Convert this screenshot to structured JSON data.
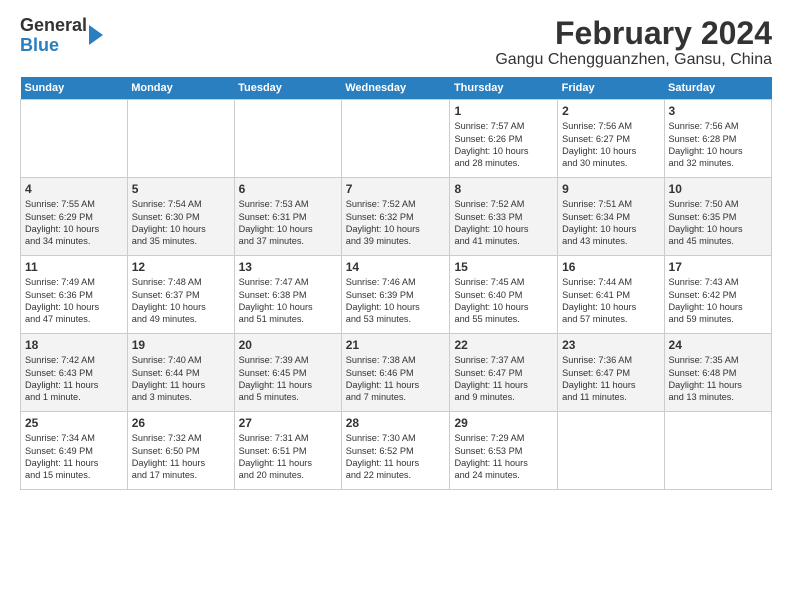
{
  "header": {
    "logo_line1": "General",
    "logo_line2": "Blue",
    "title": "February 2024",
    "subtitle": "Gangu Chengguanzhen, Gansu, China"
  },
  "weekdays": [
    "Sunday",
    "Monday",
    "Tuesday",
    "Wednesday",
    "Thursday",
    "Friday",
    "Saturday"
  ],
  "weeks": [
    [
      {
        "day": "",
        "info": ""
      },
      {
        "day": "",
        "info": ""
      },
      {
        "day": "",
        "info": ""
      },
      {
        "day": "",
        "info": ""
      },
      {
        "day": "1",
        "info": "Sunrise: 7:57 AM\nSunset: 6:26 PM\nDaylight: 10 hours\nand 28 minutes."
      },
      {
        "day": "2",
        "info": "Sunrise: 7:56 AM\nSunset: 6:27 PM\nDaylight: 10 hours\nand 30 minutes."
      },
      {
        "day": "3",
        "info": "Sunrise: 7:56 AM\nSunset: 6:28 PM\nDaylight: 10 hours\nand 32 minutes."
      }
    ],
    [
      {
        "day": "4",
        "info": "Sunrise: 7:55 AM\nSunset: 6:29 PM\nDaylight: 10 hours\nand 34 minutes."
      },
      {
        "day": "5",
        "info": "Sunrise: 7:54 AM\nSunset: 6:30 PM\nDaylight: 10 hours\nand 35 minutes."
      },
      {
        "day": "6",
        "info": "Sunrise: 7:53 AM\nSunset: 6:31 PM\nDaylight: 10 hours\nand 37 minutes."
      },
      {
        "day": "7",
        "info": "Sunrise: 7:52 AM\nSunset: 6:32 PM\nDaylight: 10 hours\nand 39 minutes."
      },
      {
        "day": "8",
        "info": "Sunrise: 7:52 AM\nSunset: 6:33 PM\nDaylight: 10 hours\nand 41 minutes."
      },
      {
        "day": "9",
        "info": "Sunrise: 7:51 AM\nSunset: 6:34 PM\nDaylight: 10 hours\nand 43 minutes."
      },
      {
        "day": "10",
        "info": "Sunrise: 7:50 AM\nSunset: 6:35 PM\nDaylight: 10 hours\nand 45 minutes."
      }
    ],
    [
      {
        "day": "11",
        "info": "Sunrise: 7:49 AM\nSunset: 6:36 PM\nDaylight: 10 hours\nand 47 minutes."
      },
      {
        "day": "12",
        "info": "Sunrise: 7:48 AM\nSunset: 6:37 PM\nDaylight: 10 hours\nand 49 minutes."
      },
      {
        "day": "13",
        "info": "Sunrise: 7:47 AM\nSunset: 6:38 PM\nDaylight: 10 hours\nand 51 minutes."
      },
      {
        "day": "14",
        "info": "Sunrise: 7:46 AM\nSunset: 6:39 PM\nDaylight: 10 hours\nand 53 minutes."
      },
      {
        "day": "15",
        "info": "Sunrise: 7:45 AM\nSunset: 6:40 PM\nDaylight: 10 hours\nand 55 minutes."
      },
      {
        "day": "16",
        "info": "Sunrise: 7:44 AM\nSunset: 6:41 PM\nDaylight: 10 hours\nand 57 minutes."
      },
      {
        "day": "17",
        "info": "Sunrise: 7:43 AM\nSunset: 6:42 PM\nDaylight: 10 hours\nand 59 minutes."
      }
    ],
    [
      {
        "day": "18",
        "info": "Sunrise: 7:42 AM\nSunset: 6:43 PM\nDaylight: 11 hours\nand 1 minute."
      },
      {
        "day": "19",
        "info": "Sunrise: 7:40 AM\nSunset: 6:44 PM\nDaylight: 11 hours\nand 3 minutes."
      },
      {
        "day": "20",
        "info": "Sunrise: 7:39 AM\nSunset: 6:45 PM\nDaylight: 11 hours\nand 5 minutes."
      },
      {
        "day": "21",
        "info": "Sunrise: 7:38 AM\nSunset: 6:46 PM\nDaylight: 11 hours\nand 7 minutes."
      },
      {
        "day": "22",
        "info": "Sunrise: 7:37 AM\nSunset: 6:47 PM\nDaylight: 11 hours\nand 9 minutes."
      },
      {
        "day": "23",
        "info": "Sunrise: 7:36 AM\nSunset: 6:47 PM\nDaylight: 11 hours\nand 11 minutes."
      },
      {
        "day": "24",
        "info": "Sunrise: 7:35 AM\nSunset: 6:48 PM\nDaylight: 11 hours\nand 13 minutes."
      }
    ],
    [
      {
        "day": "25",
        "info": "Sunrise: 7:34 AM\nSunset: 6:49 PM\nDaylight: 11 hours\nand 15 minutes."
      },
      {
        "day": "26",
        "info": "Sunrise: 7:32 AM\nSunset: 6:50 PM\nDaylight: 11 hours\nand 17 minutes."
      },
      {
        "day": "27",
        "info": "Sunrise: 7:31 AM\nSunset: 6:51 PM\nDaylight: 11 hours\nand 20 minutes."
      },
      {
        "day": "28",
        "info": "Sunrise: 7:30 AM\nSunset: 6:52 PM\nDaylight: 11 hours\nand 22 minutes."
      },
      {
        "day": "29",
        "info": "Sunrise: 7:29 AM\nSunset: 6:53 PM\nDaylight: 11 hours\nand 24 minutes."
      },
      {
        "day": "",
        "info": ""
      },
      {
        "day": "",
        "info": ""
      }
    ]
  ]
}
